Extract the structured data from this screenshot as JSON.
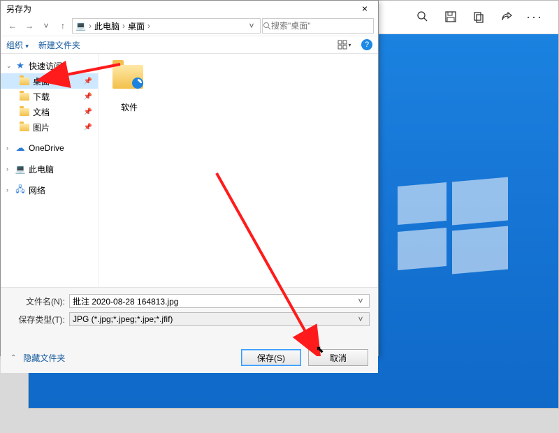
{
  "bg_app": {
    "tools": {
      "zoom": "zoom",
      "save": "save",
      "copy": "copy",
      "share": "share",
      "more": "···"
    }
  },
  "dialog": {
    "title": "另存为",
    "nav": {
      "back": "←",
      "forward": "→",
      "up": "↑"
    },
    "path": {
      "root": "此电脑",
      "current": "桌面"
    },
    "search": {
      "placeholder": "搜索\"桌面\""
    },
    "cmdbar": {
      "organize": "组织",
      "new_folder": "新建文件夹"
    },
    "tree": {
      "quick_access": "快速访问",
      "items": [
        {
          "label": "桌面"
        },
        {
          "label": "下载"
        },
        {
          "label": "文档"
        },
        {
          "label": "图片"
        }
      ],
      "onedrive": "OneDrive",
      "this_pc": "此电脑",
      "network": "网络"
    },
    "files": [
      {
        "label": "软件"
      }
    ],
    "fields": {
      "name_label": "文件名(N):",
      "name_value": "批注 2020-08-28 164813.jpg",
      "type_label": "保存类型(T):",
      "type_value": "JPG (*.jpg;*.jpeg;*.jpe;*.jfif)"
    },
    "footer": {
      "hide_folders": "隐藏文件夹",
      "save": "保存(S)",
      "cancel": "取消"
    }
  }
}
